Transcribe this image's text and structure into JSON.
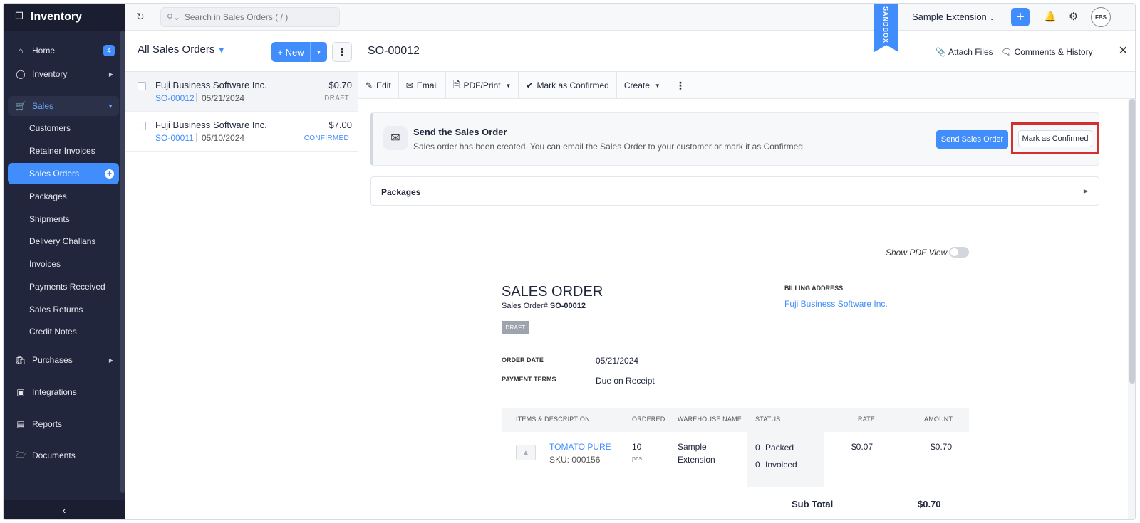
{
  "app": {
    "name": "Inventory"
  },
  "sidebar": {
    "items": [
      {
        "label": "Home",
        "badge": "4",
        "icon": "home-icon"
      },
      {
        "label": "Inventory",
        "icon": "inventory-icon"
      },
      {
        "label": "Sales",
        "icon": "cart-icon"
      },
      {
        "label": "Purchases",
        "icon": "bag-icon"
      },
      {
        "label": "Integrations",
        "icon": "integrations-icon"
      },
      {
        "label": "Reports",
        "icon": "reports-icon"
      },
      {
        "label": "Documents",
        "icon": "folder-icon"
      }
    ],
    "sales_sub": [
      "Customers",
      "Retainer Invoices",
      "Sales Orders",
      "Packages",
      "Shipments",
      "Delivery Challans",
      "Invoices",
      "Payments Received",
      "Sales Returns",
      "Credit Notes"
    ]
  },
  "topbar": {
    "search_placeholder": "Search in Sales Orders ( / )",
    "sandbox": "SANDBOX",
    "org": "Sample Extension",
    "avatar": "FBS"
  },
  "list": {
    "title": "All Sales Orders",
    "new_label": "+ New",
    "rows": [
      {
        "customer": "Fuji Business Software Inc.",
        "amount": "$0.70",
        "so": "SO-00012",
        "date": "05/21/2024",
        "status": "DRAFT"
      },
      {
        "customer": "Fuji Business Software Inc.",
        "amount": "$7.00",
        "so": "SO-00011",
        "date": "05/10/2024",
        "status": "CONFIRMED"
      }
    ]
  },
  "detail": {
    "title": "SO-00012",
    "attach": "Attach Files",
    "comments": "Comments & History",
    "toolbar": {
      "edit": "Edit",
      "email": "Email",
      "pdf": "PDF/Print",
      "mark": "Mark as Confirmed",
      "create": "Create"
    },
    "banner": {
      "title": "Send the Sales Order",
      "text": "Sales order has been created. You can email the Sales Order to your customer or mark it as Confirmed.",
      "send": "Send Sales Order",
      "confirm": "Mark as Confirmed"
    },
    "packages": "Packages",
    "pdf_view": "Show PDF View",
    "doc": {
      "title": "SALES ORDER",
      "number_label": "Sales Order#",
      "number": "SO-00012",
      "status": "DRAFT",
      "billing_label": "BILLING ADDRESS",
      "billing_name": "Fuji Business Software Inc.",
      "order_date_label": "ORDER DATE",
      "order_date": "05/21/2024",
      "terms_label": "PAYMENT TERMS",
      "terms": "Due on Receipt",
      "columns": [
        "ITEMS & DESCRIPTION",
        "ORDERED",
        "WAREHOUSE NAME",
        "STATUS",
        "RATE",
        "AMOUNT"
      ],
      "item": {
        "name": "TOMATO PURE",
        "sku": "SKU: 000156",
        "qty": "10",
        "unit": "pcs",
        "warehouse_1": "Sample",
        "warehouse_2": "Extension",
        "packed_count": "0",
        "packed_label": "Packed",
        "invoiced_count": "0",
        "invoiced_label": "Invoiced",
        "rate": "$0.07",
        "amount": "$0.70"
      },
      "subtotal_label": "Sub Total",
      "subtotal": "$0.70"
    }
  }
}
